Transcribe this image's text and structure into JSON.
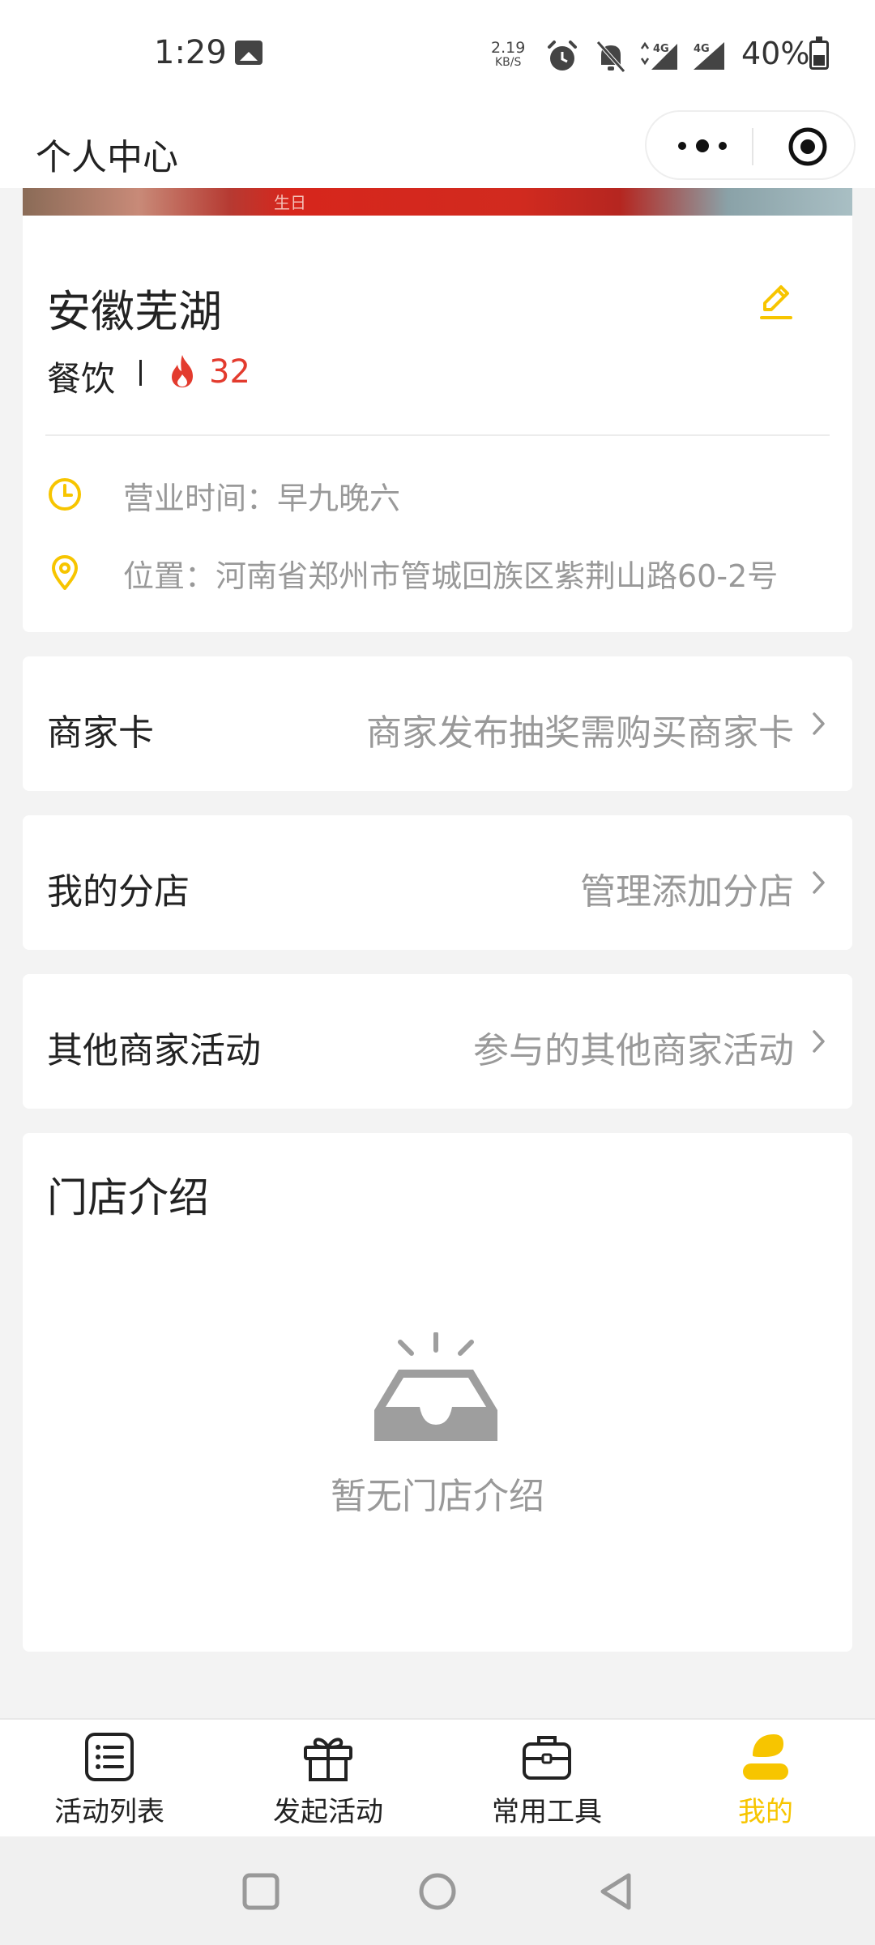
{
  "status_bar": {
    "time": "1:29",
    "net_speed": "2.19",
    "net_speed_unit": "KB/S",
    "battery": "40%",
    "icons": [
      "photo-icon",
      "alarm-icon",
      "mute-icon",
      "signal-4g-icon",
      "signal-4g-icon",
      "battery-icon"
    ]
  },
  "header": {
    "title": "个人中心",
    "capsule": [
      "more-icon",
      "target-icon"
    ]
  },
  "banner": {
    "text": "生日"
  },
  "profile": {
    "name": "安徽芜湖",
    "category": "餐饮",
    "hot_count": "32",
    "hours": "营业时间：早九晚六",
    "location": "位置：河南省郑州市管城回族区紫荆山路60-2号"
  },
  "menu": [
    {
      "label": "商家卡",
      "value": "商家发布抽奖需购买商家卡"
    },
    {
      "label": "我的分店",
      "value": "管理添加分店"
    },
    {
      "label": "其他商家活动",
      "value": "参与的其他商家活动"
    }
  ],
  "intro": {
    "title": "门店介绍",
    "empty_text": "暂无门店介绍"
  },
  "tabs": [
    {
      "label": "活动列表",
      "icon": "list-icon"
    },
    {
      "label": "发起活动",
      "icon": "gift-icon"
    },
    {
      "label": "常用工具",
      "icon": "briefcase-icon"
    },
    {
      "label": "我的",
      "icon": "user-icon",
      "active": true
    }
  ],
  "colors": {
    "accent": "#f7c500",
    "hot": "#e33b2e",
    "muted_text": "#999999",
    "background": "#f3f3f3"
  }
}
